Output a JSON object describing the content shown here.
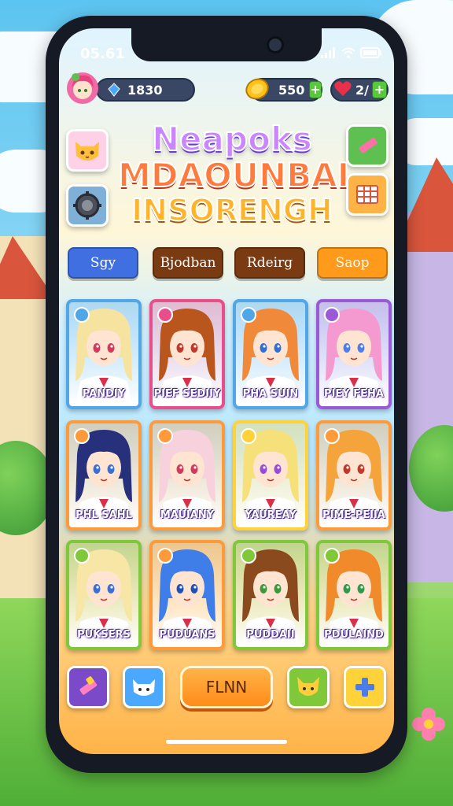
{
  "status_bar": {
    "time": "05.61"
  },
  "top_bar": {
    "gems": "1830",
    "coins": "550",
    "lives": "2/"
  },
  "title": {
    "line1": "Neapoks",
    "line2": "MDAOUNBAI",
    "line3": "INSORENGH"
  },
  "tabs": [
    {
      "label": "Sgy",
      "color": "#3f6fe0"
    },
    {
      "label": "Bjodban",
      "color": "#7a3a12"
    },
    {
      "label": "Rdeirg",
      "color": "#7a3a12"
    },
    {
      "label": "Saop",
      "color": "#ff9a1a"
    }
  ],
  "cards": [
    {
      "name": "PANDIY",
      "hair": "#f6e3a0",
      "eyes": "#d13a5a",
      "border": "#4fa7e8"
    },
    {
      "name": "PIEF SEDIIY",
      "hair": "#b8561e",
      "eyes": "#c0392b",
      "border": "#e94d8c"
    },
    {
      "name": "PHA SUIN",
      "hair": "#f08a3a",
      "eyes": "#2f6fd6",
      "border": "#4fa7e8"
    },
    {
      "name": "PIEY FEHA",
      "hair": "#f59ad0",
      "eyes": "#4d7cf0",
      "border": "#9a5ad8"
    },
    {
      "name": "PHL SAHL",
      "hair": "#27307a",
      "eyes": "#3a6fd8",
      "border": "#ff9a3a"
    },
    {
      "name": "MAUIANY",
      "hair": "#f7d1dc",
      "eyes": "#d13a5a",
      "border": "#ff9a3a"
    },
    {
      "name": "YAUREAY",
      "hair": "#f6e07a",
      "eyes": "#9a4ad8",
      "border": "#ffd23a"
    },
    {
      "name": "PIME-PEIIA",
      "hair": "#f4a43a",
      "eyes": "#c0392b",
      "border": "#ff9a3a"
    },
    {
      "name": "PUKSERS",
      "hair": "#f8e6a6",
      "eyes": "#3a6fd8",
      "border": "#7ec83a"
    },
    {
      "name": "PUDUANS",
      "hair": "#3f7de8",
      "eyes": "#1f4fb8",
      "border": "#ff9a3a"
    },
    {
      "name": "PUDDAII",
      "hair": "#8a4a1e",
      "eyes": "#3a9a3a",
      "border": "#7ec83a"
    },
    {
      "name": "PDULAIND",
      "hair": "#f08a2a",
      "eyes": "#2f9a4a",
      "border": "#7ec83a"
    }
  ],
  "bottom_bar": {
    "play_label": "FLNN"
  },
  "icons": {
    "avatar": "avatar-icon",
    "gem": "gem-icon",
    "coin": "coin-icon",
    "heart": "heart-icon",
    "cat": "cat-icon",
    "gear": "gear-icon",
    "pencil": "pencil-icon",
    "grid": "grid-icon",
    "paint": "paint-brush-icon",
    "paw": "cat-face-icon",
    "fox": "fox-icon",
    "plus": "plus-icon"
  }
}
